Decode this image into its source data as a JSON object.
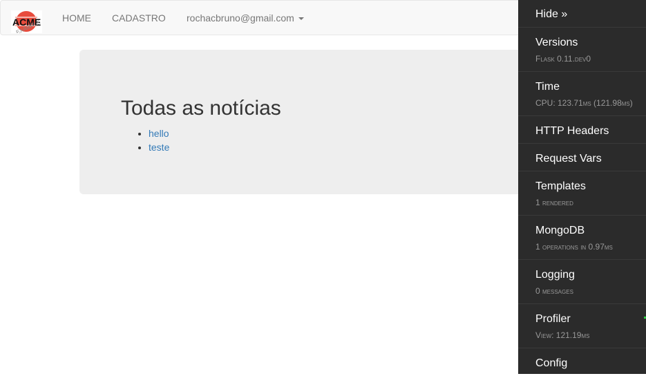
{
  "navbar": {
    "brand_alt": "ACME Example logo",
    "links": [
      {
        "label": "HOME"
      },
      {
        "label": "CADASTRO"
      },
      {
        "label": "rochacbruno@gmail.com"
      }
    ]
  },
  "main": {
    "title": "Todas as notícias",
    "news": [
      "hello",
      "teste"
    ]
  },
  "debug_toolbar": {
    "hide_label": "Hide »",
    "panels": [
      {
        "title": "Versions",
        "subtitle": "Flask 0.11.dev0"
      },
      {
        "title": "Time",
        "subtitle": "CPU: 123.71ms (121.98ms)"
      },
      {
        "title": "HTTP Headers"
      },
      {
        "title": "Request Vars"
      },
      {
        "title": "Templates",
        "subtitle": "1 rendered"
      },
      {
        "title": "MongoDB",
        "subtitle": "1 operations in 0.97ms"
      },
      {
        "title": "Logging",
        "subtitle": "0 messages"
      },
      {
        "title": "Profiler",
        "subtitle": "View: 121.19ms"
      },
      {
        "title": "Config"
      }
    ]
  }
}
